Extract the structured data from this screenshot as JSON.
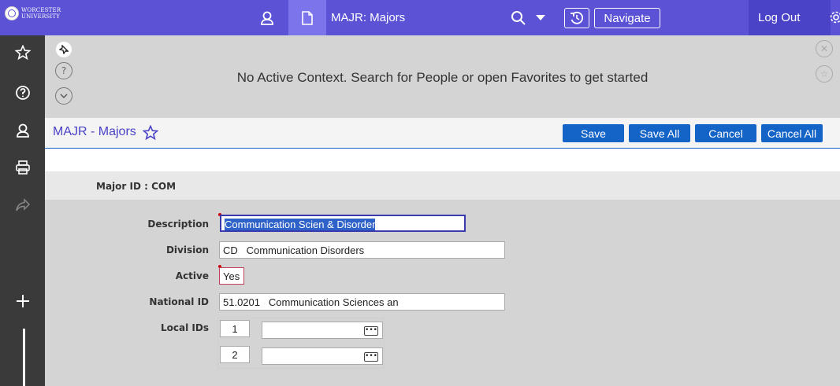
{
  "topbar": {
    "logo_text_line1": "WORCESTER",
    "logo_text_line2": "UNIVERSITY",
    "title": "MAJR: Majors",
    "navigate_label": "Navigate",
    "logout_label": "Log Out",
    "accent_color": "#5b52d6"
  },
  "context": {
    "message": "No Active Context. Search for People or open Favorites to get started"
  },
  "form": {
    "title": "MAJR - Majors",
    "buttons": {
      "save": "Save",
      "save_all": "Save All",
      "cancel": "Cancel",
      "cancel_all": "Cancel All"
    },
    "key_label": "Major ID :",
    "key_value": "COM",
    "fields": {
      "description_label": "Description",
      "description_value": "Communication Scien & Disorder",
      "division_label": "Division",
      "division_value": "CD   Communication Disorders",
      "active_label": "Active",
      "active_value": "Yes",
      "national_id_label": "National ID",
      "national_id_value": "51.0201   Communication Sciences an",
      "local_ids_label": "Local IDs",
      "local_ids": [
        {
          "index": "1",
          "value": ""
        },
        {
          "index": "2",
          "value": ""
        }
      ]
    }
  }
}
